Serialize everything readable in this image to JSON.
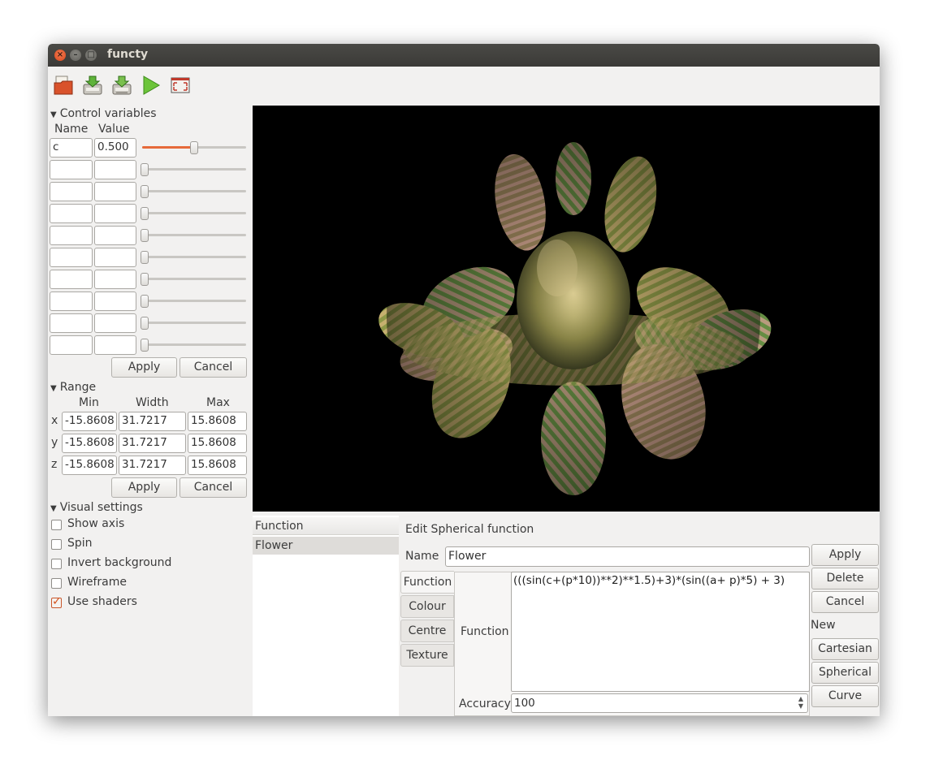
{
  "window": {
    "title": "functy"
  },
  "toolbar": {
    "icons": [
      "open-file-icon",
      "save-icon",
      "save-as-icon",
      "play-icon",
      "fullscreen-icon"
    ]
  },
  "control_variables": {
    "header": "Control variables",
    "col_name": "Name",
    "col_value": "Value",
    "rows": [
      {
        "name": "c",
        "value": "0.500",
        "slider": 0.5
      },
      {
        "name": "",
        "value": "",
        "slider": 0
      },
      {
        "name": "",
        "value": "",
        "slider": 0
      },
      {
        "name": "",
        "value": "",
        "slider": 0
      },
      {
        "name": "",
        "value": "",
        "slider": 0
      },
      {
        "name": "",
        "value": "",
        "slider": 0
      },
      {
        "name": "",
        "value": "",
        "slider": 0
      },
      {
        "name": "",
        "value": "",
        "slider": 0
      },
      {
        "name": "",
        "value": "",
        "slider": 0
      },
      {
        "name": "",
        "value": "",
        "slider": 0
      }
    ],
    "apply": "Apply",
    "cancel": "Cancel"
  },
  "range": {
    "header": "Range",
    "col_min": "Min",
    "col_width": "Width",
    "col_max": "Max",
    "rows": [
      {
        "axis": "x",
        "min": "-15.8608",
        "width": "31.7217",
        "max": "15.8608"
      },
      {
        "axis": "y",
        "min": "-15.8608",
        "width": "31.7217",
        "max": "15.8608"
      },
      {
        "axis": "z",
        "min": "-15.8608",
        "width": "31.7217",
        "max": "15.8608"
      }
    ],
    "apply": "Apply",
    "cancel": "Cancel"
  },
  "visual": {
    "header": "Visual settings",
    "options": [
      {
        "label": "Show axis",
        "checked": false
      },
      {
        "label": "Spin",
        "checked": false
      },
      {
        "label": "Invert background",
        "checked": false
      },
      {
        "label": "Wireframe",
        "checked": false
      },
      {
        "label": "Use shaders",
        "checked": true
      }
    ]
  },
  "function_list": {
    "header": "Function",
    "items": [
      "Flower"
    ]
  },
  "editor": {
    "title": "Edit Spherical function",
    "name_label": "Name",
    "name_value": "Flower",
    "tabs": [
      "Function",
      "Colour",
      "Centre",
      "Texture"
    ],
    "function_label": "Function",
    "function_value": "(((sin(c+(p*10))**2)**1.5)+3)*(sin((a+ p)*5) + 3)",
    "accuracy_label": "Accuracy",
    "accuracy_value": "100",
    "buttons": {
      "apply": "Apply",
      "delete": "Delete",
      "cancel": "Cancel"
    },
    "new_label": "New",
    "new_buttons": {
      "cartesian": "Cartesian",
      "spherical": "Spherical",
      "curve": "Curve"
    }
  },
  "colors": {
    "accent": "#e66a3a",
    "titlebar": "#3b3a37",
    "viewport": "#000000"
  }
}
